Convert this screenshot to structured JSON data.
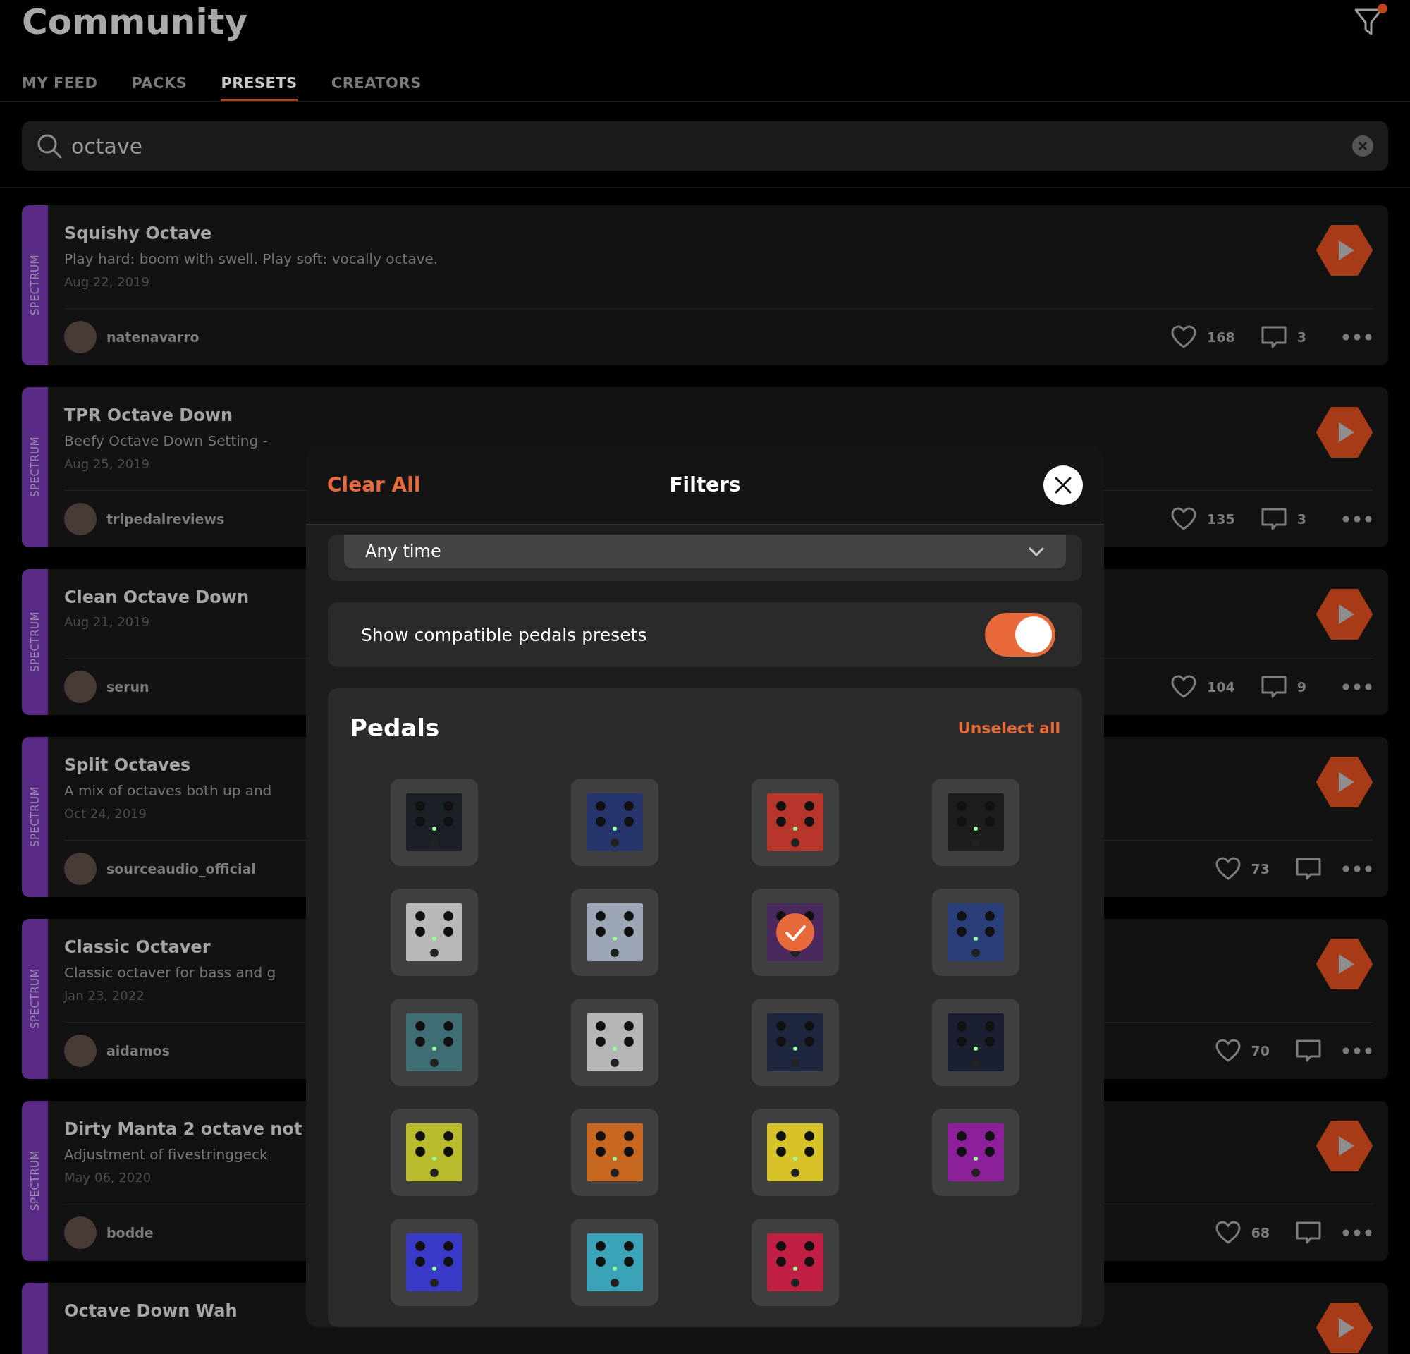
{
  "header": {
    "title": "Community"
  },
  "tabs": [
    {
      "label": "MY FEED",
      "selected": false
    },
    {
      "label": "PACKS",
      "selected": false
    },
    {
      "label": "PRESETS",
      "selected": true
    },
    {
      "label": "CREATORS",
      "selected": false
    }
  ],
  "search": {
    "value": "octave"
  },
  "presets": [
    {
      "tag": "SPECTRUM",
      "title": "Squishy Octave",
      "description": "Play hard: boom with swell. Play soft: vocally octave.",
      "date": "Aug 22, 2019",
      "author": "natenavarro",
      "likes": "168",
      "comments": "3"
    },
    {
      "tag": "SPECTRUM",
      "title": "TPR Octave Down",
      "description": "Beefy Octave Down Setting -",
      "date": "Aug 25, 2019",
      "author": "tripedalreviews",
      "likes": "135",
      "comments": "3"
    },
    {
      "tag": "SPECTRUM",
      "title": "Clean Octave Down",
      "date": "Aug 21, 2019",
      "author": "serun",
      "likes": "104",
      "comments": "9"
    },
    {
      "tag": "SPECTRUM",
      "title": "Split Octaves",
      "description": "A mix of octaves both up and",
      "date": "Oct 24, 2019",
      "author": "sourceaudio_official",
      "likes": "73"
    },
    {
      "tag": "SPECTRUM",
      "title": "Classic Octaver",
      "description": "Classic octaver for bass and g",
      "date": "Jan 23, 2022",
      "author": "aidamos",
      "likes": "70"
    },
    {
      "tag": "SPECTRUM",
      "title": "Dirty Manta 2 octave not",
      "description": "Adjustment of fivestringgeck",
      "date": "May 06, 2020",
      "author": "bodde",
      "likes": "68"
    },
    {
      "title": "Octave Down Wah"
    }
  ],
  "filters": {
    "clear_label": "Clear All",
    "title": "Filters",
    "time": {
      "value": "Any time"
    },
    "compatible": {
      "label": "Show compatible pedals presets",
      "on": true
    },
    "pedals": {
      "title": "Pedals",
      "unselect_label": "Unselect all",
      "items": [
        {
          "color": "#1b2026",
          "selected": false
        },
        {
          "color": "#26356c",
          "selected": false
        },
        {
          "color": "#b8352c",
          "selected": false
        },
        {
          "color": "#1d1d1d",
          "selected": false
        },
        {
          "color": "#b9b9b9",
          "selected": false
        },
        {
          "color": "#9ca6b4",
          "selected": false
        },
        {
          "color": "#4a2a5e",
          "selected": true
        },
        {
          "color": "#2a3f7a",
          "selected": false
        },
        {
          "color": "#3f6e75",
          "selected": false
        },
        {
          "color": "#b4b6b8",
          "selected": false
        },
        {
          "color": "#1f2640",
          "selected": false
        },
        {
          "color": "#1a2030",
          "selected": false
        },
        {
          "color": "#b7bb2c",
          "selected": false
        },
        {
          "color": "#c8671f",
          "selected": false
        },
        {
          "color": "#d8c22a",
          "selected": false
        },
        {
          "color": "#8c1f9a",
          "selected": false
        },
        {
          "color": "#3a3ac8",
          "selected": false
        },
        {
          "color": "#3aa3b8",
          "selected": false
        },
        {
          "color": "#c21f45",
          "selected": false
        }
      ]
    }
  }
}
